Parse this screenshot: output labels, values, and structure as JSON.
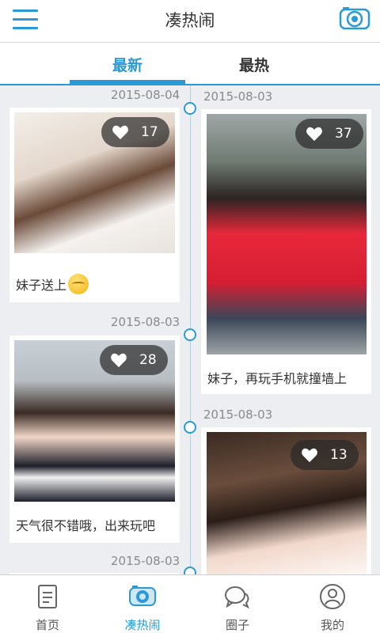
{
  "header": {
    "title": "凑热闹"
  },
  "tabs": [
    {
      "label": "最新"
    },
    {
      "label": "最热"
    }
  ],
  "posts": [
    {
      "date": "2015-08-04",
      "likes": "17",
      "caption": "妹子送上",
      "has_emoji": true
    },
    {
      "date": "2015-08-03",
      "likes": "37",
      "caption": "妹子，再玩手机就撞墙上"
    },
    {
      "date": "2015-08-03",
      "likes": "28",
      "caption": "天气很不错哦，出来玩吧"
    },
    {
      "date": "2015-08-03",
      "likes": "13",
      "caption": ""
    },
    {
      "date": "2015-08-03"
    }
  ],
  "nav": [
    {
      "label": "首页",
      "icon": "document-icon"
    },
    {
      "label": "凑热闹",
      "icon": "camera-icon"
    },
    {
      "label": "圈子",
      "icon": "chat-bubbles-icon"
    },
    {
      "label": "我的",
      "icon": "user-icon"
    }
  ],
  "colors": {
    "accent": "#2a9ad6",
    "background": "#eceef2"
  }
}
